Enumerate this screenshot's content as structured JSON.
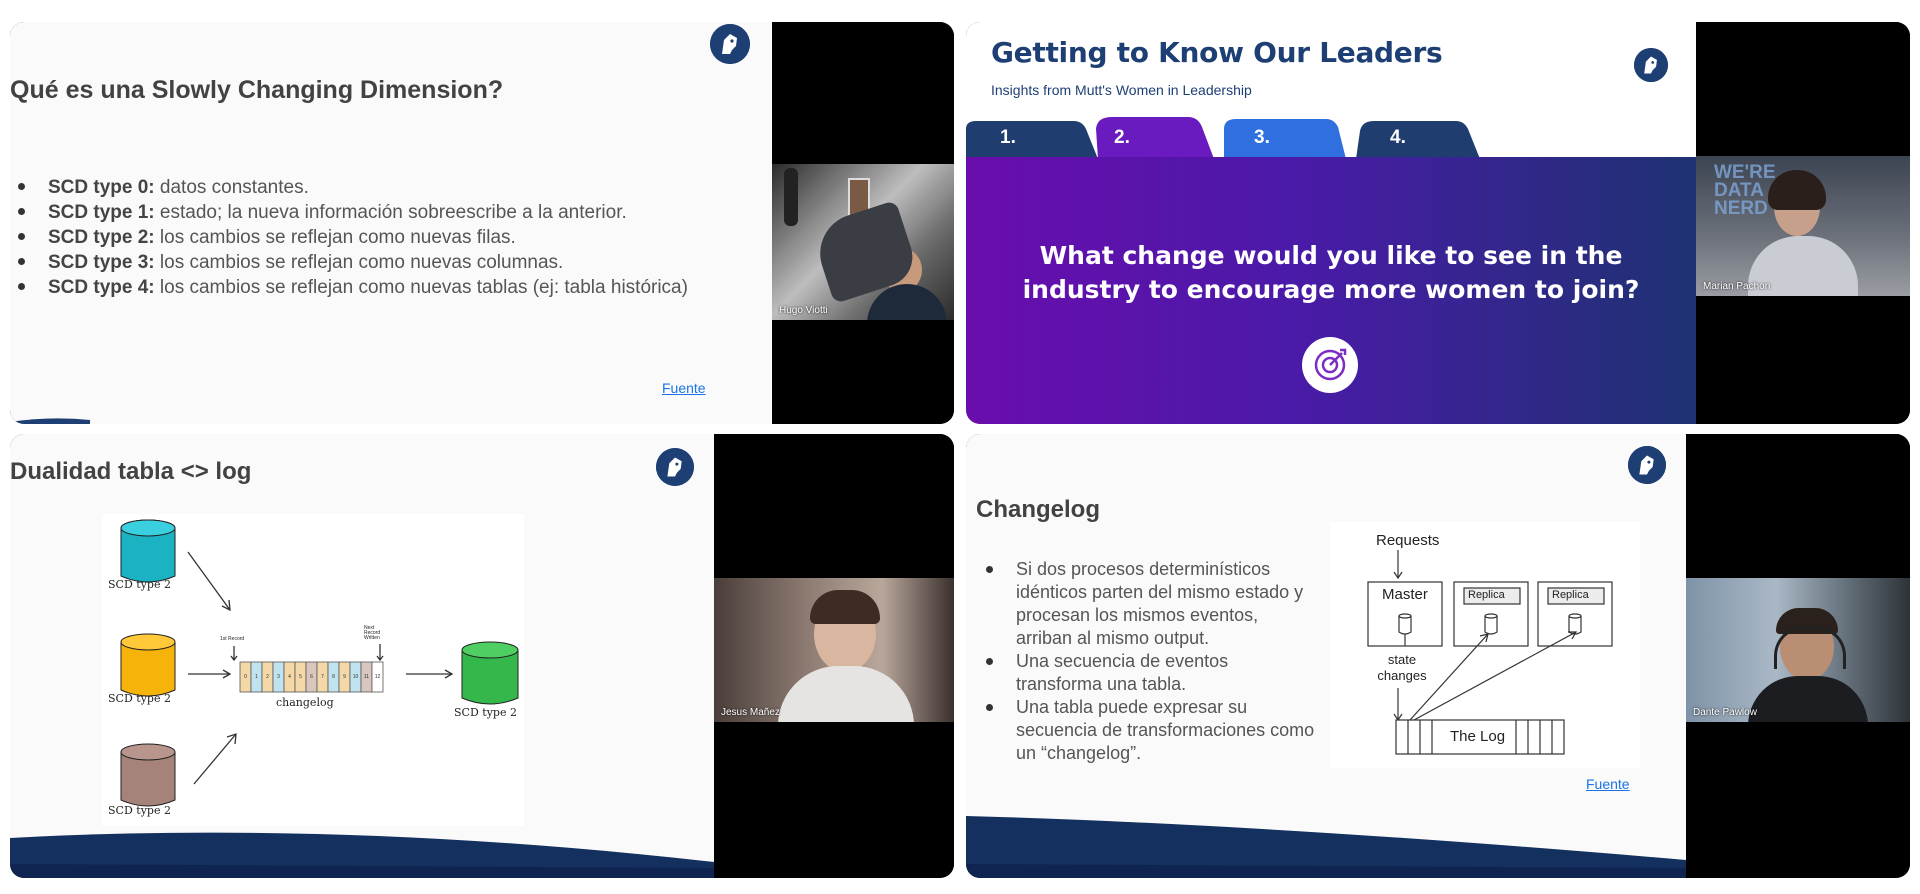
{
  "tiles": [
    {
      "slide": {
        "title": "Qué es una Slowly Changing Dimension?",
        "bullets": [
          {
            "bold": "SCD type 0:",
            "text": " datos constantes."
          },
          {
            "bold": "SCD type 1:",
            "text": " estado; la nueva información sobreescribe a la anterior."
          },
          {
            "bold": "SCD type 2:",
            "text": " los cambios se reflejan como nuevas filas."
          },
          {
            "bold": "SCD type 3:",
            "text": " los cambios se reflejan como nuevas columnas."
          },
          {
            "bold": "SCD type 4:",
            "text": " los cambios se reflejan como nuevas tablas (ej: tabla histórica)"
          }
        ],
        "link": "Fuente"
      },
      "participant": "Hugo Viotti"
    },
    {
      "slide": {
        "title": "Getting to Know Our Leaders",
        "subtitle": "Insights from Mutt's Women in Leadership",
        "tabs": [
          "1.",
          "2.",
          "3.",
          "4."
        ],
        "question_line1": "What change would you like to see in the",
        "question_line2": "industry to encourage more women to join?"
      },
      "participant": "Marian Pachon",
      "wall_text": [
        "WE'RE",
        "DATA",
        "NERD"
      ]
    },
    {
      "slide": {
        "title": "Dualidad tabla <> log",
        "db_labels": [
          "SCD type 2",
          "SCD type 2",
          "SCD type 2",
          "SCD type 2"
        ],
        "log_label": "changelog",
        "first_record": "1st Record",
        "next_record": "Next Record Written",
        "cells": [
          "0",
          "1",
          "2",
          "3",
          "4",
          "5",
          "6",
          "7",
          "8",
          "9",
          "10",
          "11",
          "12"
        ]
      },
      "participant": "Jesus Mañez"
    },
    {
      "slide": {
        "title": "Changelog",
        "bullets": [
          "Si dos procesos determinísticos idénticos parten del mismo estado y procesan los mismos eventos, arriban al mismo output.",
          "Una secuencia de eventos transforma una tabla.",
          "Una tabla puede expresar su secuencia de transformaciones como un “changelog”."
        ],
        "link": "Fuente",
        "diagram": {
          "requests": "Requests",
          "master": "Master",
          "replica": "Replica",
          "state_changes": "state changes",
          "log": "The Log"
        }
      },
      "participant": "Dante Pawlow"
    }
  ],
  "colors": {
    "brand_navy": "#1e3f74",
    "tab_navy": "#1f3d6e",
    "tab_purple": "#6a1bbf",
    "tab_blue": "#2f6fe0",
    "purple": "#6a0dad"
  }
}
